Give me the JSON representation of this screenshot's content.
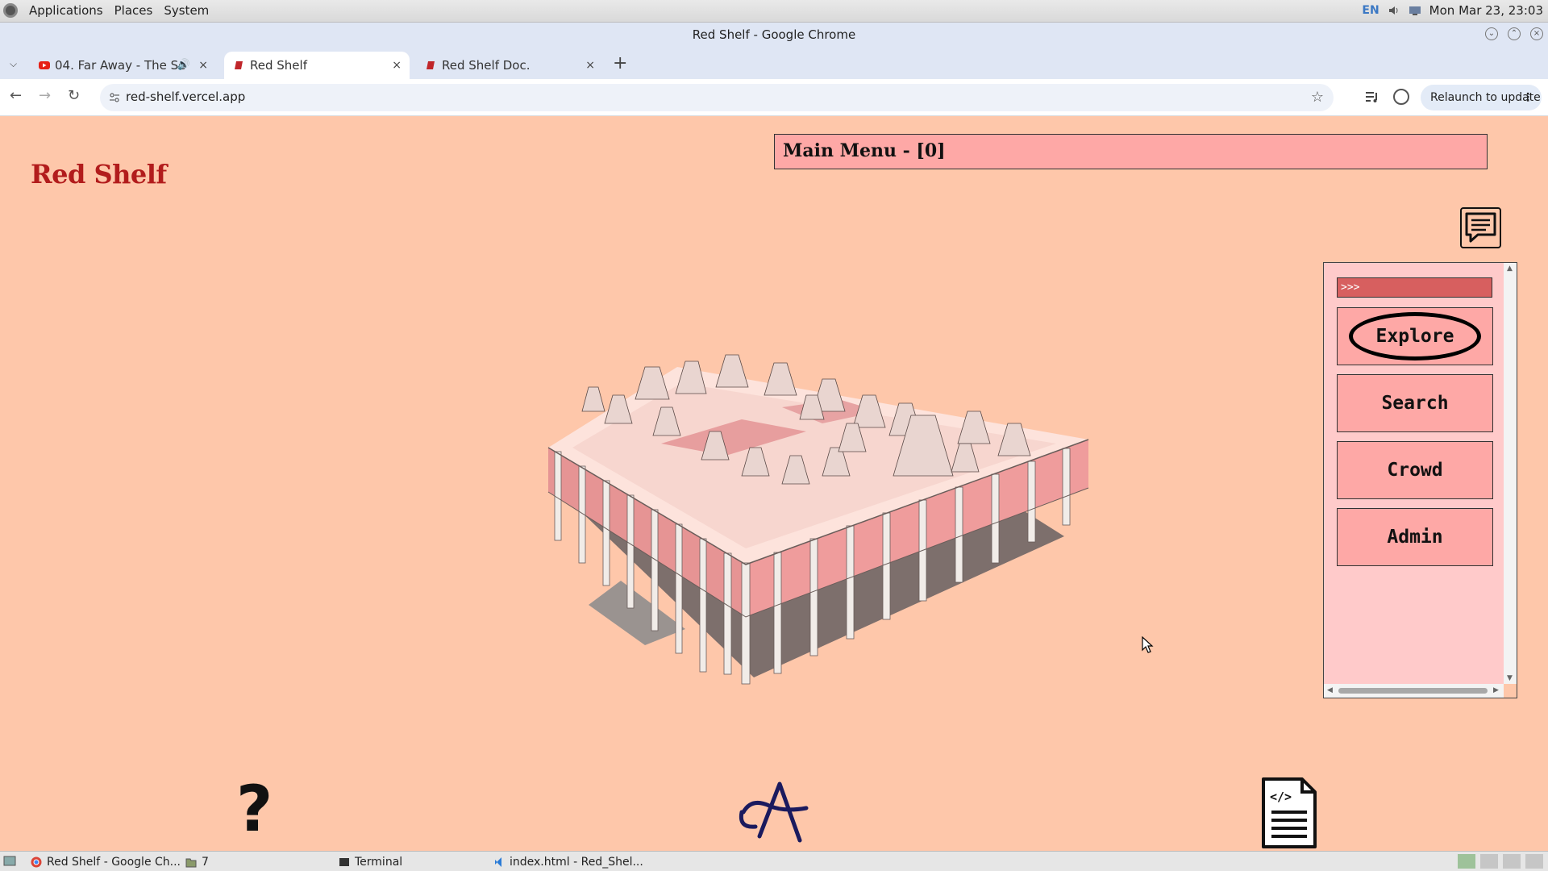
{
  "top_panel": {
    "menus": [
      "Applications",
      "Places",
      "System"
    ],
    "keyboard_layout": "EN",
    "clock": "Mon Mar 23, 23:03"
  },
  "window": {
    "title": "Red Shelf - Google Chrome"
  },
  "tabs": [
    {
      "title": "04. Far Away - The Se",
      "favicon": "youtube-icon",
      "audio": "speaker-icon"
    },
    {
      "title": "Red Shelf",
      "favicon": "red-shelf-icon"
    },
    {
      "title": "Red Shelf Doc.",
      "favicon": "red-shelf-icon"
    }
  ],
  "toolbar": {
    "url": "red-shelf.vercel.app",
    "relaunch_label": "Relaunch to update"
  },
  "page": {
    "site_title": "Red Shelf",
    "menu_header": "Main Menu - [0]",
    "command_prompt": ">>>",
    "menu_buttons": [
      "Explore",
      "Search",
      "Crowd",
      "Admin"
    ],
    "help_symbol": "?",
    "colors": {
      "background": "#fec7aa",
      "header_fill": "#fea8a6",
      "title_red": "#b21c1c",
      "input_fill": "#d75f5f",
      "panel_fill": "#ffcaca"
    }
  },
  "taskbar": {
    "items": [
      {
        "label": "Red Shelf - Google Ch...",
        "icon": "chrome-icon"
      },
      {
        "label": "7",
        "icon": "folder-icon"
      },
      {
        "label": "Terminal",
        "icon": "terminal-icon"
      },
      {
        "label": "index.html - Red_Shel...",
        "icon": "vscode-icon"
      }
    ]
  }
}
